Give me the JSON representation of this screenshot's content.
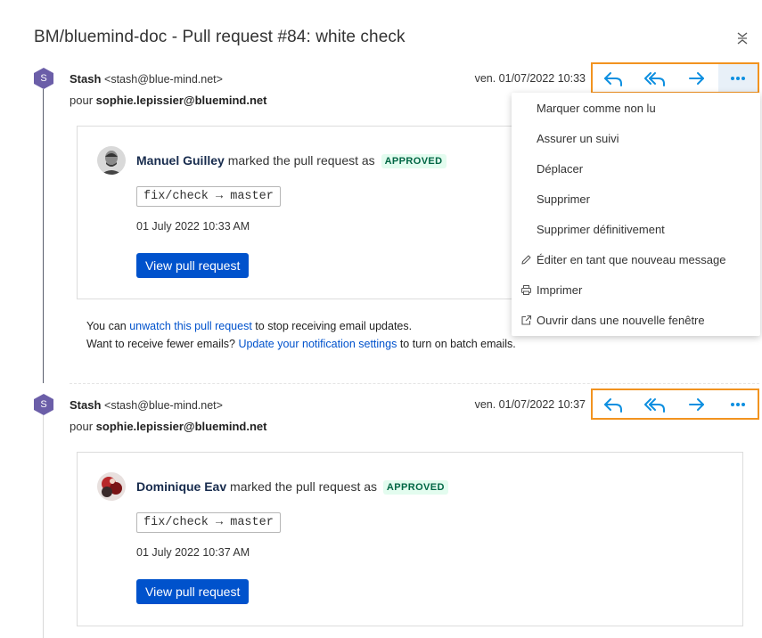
{
  "title": "BM/bluemind-doc - Pull request #84: white check",
  "messages": [
    {
      "avatar_letter": "S",
      "sender_name": "Stash",
      "sender_addr": "<stash@blue-mind.net>",
      "recipient_prefix": "pour",
      "recipient": "sophie.lepissier@bluemind.net",
      "date": "ven. 01/07/2022 10:33",
      "card": {
        "user": "Manuel Guilley",
        "action": "marked the pull request as",
        "status": "APPROVED",
        "branch": "fix/check → master",
        "timestamp": "01 July 2022 10:33 AM",
        "button": "View pull request"
      }
    },
    {
      "avatar_letter": "S",
      "sender_name": "Stash",
      "sender_addr": "<stash@blue-mind.net>",
      "recipient_prefix": "pour",
      "recipient": "sophie.lepissier@bluemind.net",
      "date": "ven. 01/07/2022 10:37",
      "card": {
        "user": "Dominique Eav",
        "action": "marked the pull request as",
        "status": "APPROVED",
        "branch": "fix/check → master",
        "timestamp": "01 July 2022 10:37 AM",
        "button": "View pull request"
      }
    }
  ],
  "footer": {
    "line1_pre": "You can",
    "line1_link": "unwatch this pull request",
    "line1_post": "to stop receiving email updates.",
    "line2_pre": "Want to receive fewer emails?",
    "line2_link": "Update your notification settings",
    "line2_post": "to turn on batch emails."
  },
  "menu": {
    "items": [
      {
        "label": "Marquer comme non lu",
        "icon": ""
      },
      {
        "label": "Assurer un suivi",
        "icon": ""
      },
      {
        "label": "Déplacer",
        "icon": ""
      },
      {
        "label": "Supprimer",
        "icon": ""
      },
      {
        "label": "Supprimer définitivement",
        "icon": ""
      },
      {
        "label": "Éditer en tant que nouveau message",
        "icon": "pencil-icon"
      },
      {
        "label": "Imprimer",
        "icon": "printer-icon"
      },
      {
        "label": "Ouvrir dans une nouvelle fenêtre",
        "icon": "external-link-icon"
      }
    ]
  },
  "colors": {
    "accent": "#0d8fe0",
    "toolbar_border": "#f2931f",
    "avatar_hex": "#6b5ea8",
    "button_blue": "#0052cc",
    "approved_bg": "#e3fcef",
    "approved_fg": "#006644"
  },
  "toolbar_icons": [
    "reply-icon",
    "reply-all-icon",
    "forward-icon",
    "more-icon"
  ]
}
